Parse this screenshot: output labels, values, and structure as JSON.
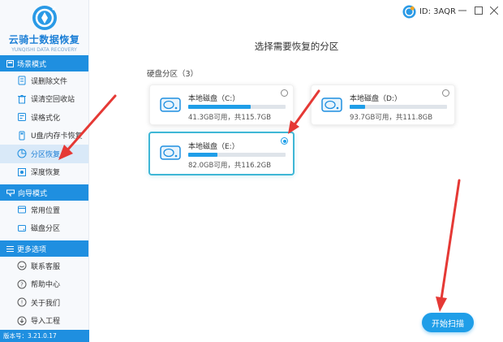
{
  "app": {
    "logo_title": "云骑士数据恢复",
    "logo_subtitle": "YUNQISHI DATA RECOVERY"
  },
  "sidebar": {
    "sections": [
      {
        "title": "场景模式",
        "items": [
          {
            "label": "误删除文件",
            "icon": "trash-file-icon"
          },
          {
            "label": "误清空回收站",
            "icon": "recycle-bin-icon"
          },
          {
            "label": "误格式化",
            "icon": "format-icon"
          },
          {
            "label": "U盘/内存卡恢复",
            "icon": "usb-card-icon"
          },
          {
            "label": "分区恢复",
            "icon": "partition-icon",
            "active": true
          },
          {
            "label": "深度恢复",
            "icon": "deep-scan-icon"
          }
        ]
      },
      {
        "title": "向导模式",
        "items": [
          {
            "label": "常用位置",
            "icon": "location-icon"
          },
          {
            "label": "磁盘分区",
            "icon": "disk-icon"
          }
        ]
      },
      {
        "title": "更多选项",
        "items": [
          {
            "label": "联系客服",
            "icon": "support-icon"
          },
          {
            "label": "帮助中心",
            "icon": "help-icon"
          },
          {
            "label": "关于我们",
            "icon": "info-icon"
          },
          {
            "label": "导入工程",
            "icon": "import-icon"
          }
        ]
      }
    ],
    "version": "版本号：3.21.0.17"
  },
  "topbar": {
    "user_id": "ID: 3AQR"
  },
  "main": {
    "title": "选择需要恢复的分区",
    "disk_group_label": "硬盘分区（3）",
    "partitions": [
      {
        "name": "本地磁盘（C:）",
        "usage": 0.64,
        "info": "41.3GB可用，共115.7GB",
        "selected": false
      },
      {
        "name": "本地磁盘（D:）",
        "usage": 0.16,
        "info": "93.7GB可用，共111.8GB",
        "selected": false
      },
      {
        "name": "本地磁盘（E:）",
        "usage": 0.3,
        "info": "82.0GB可用，共116.2GB",
        "selected": true
      }
    ],
    "start_button": "开始扫描"
  },
  "colors": {
    "accent": "#1f9ee8",
    "sidebar_header": "#1f8fe0",
    "annotation_arrow": "#e53935"
  }
}
